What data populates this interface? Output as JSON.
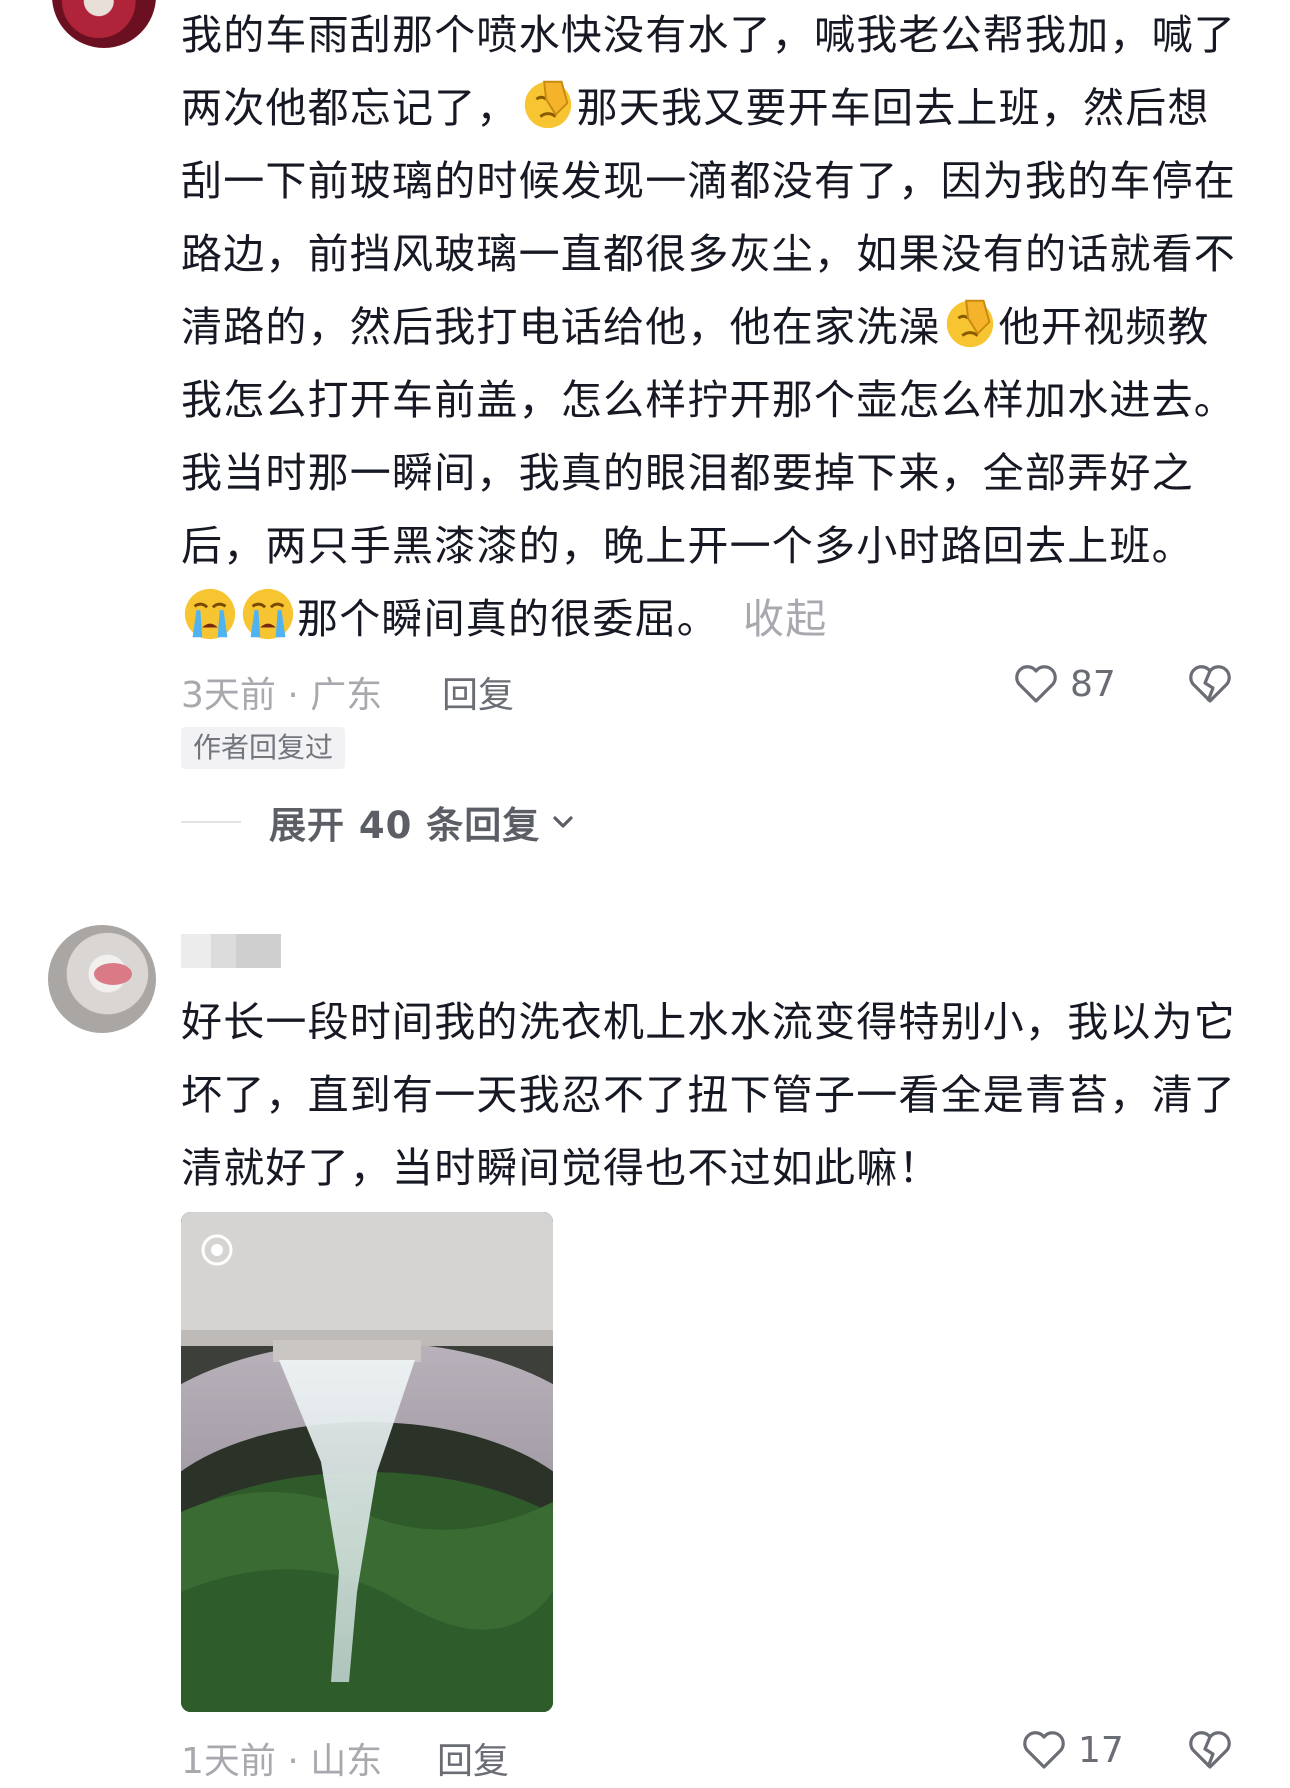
{
  "comments": [
    {
      "text_parts": [
        "我的车雨刮那个喷水快没有水了，喊我老公帮我加，喊了两次他都忘记了，",
        "那天我又要开车回去上班，然后想刮一下前玻璃的时候发现一滴都没有了，因为我的车停在路边，前挡风玻璃一直都很多灰尘，如果没有的话就看不清路的，然后我打电话给他，他在家洗澡",
        "他开视频教我怎么打开车前盖，怎么样拧开那个壶怎么样加水进去。我当时那一瞬间，我真的眼泪都要掉下来，全部弄好之后，两只手黑漆漆的，晚上开一个多小时路回去上班。",
        "那个瞬间真的很委屈。"
      ],
      "fold_label": "收起",
      "time_location": "3天前 · 广东",
      "reply_label": "回复",
      "like_count": "87",
      "author_badge": "作者回复过",
      "expand_replies": "展开 40 条回复",
      "emojis": [
        "facepalm-emoji",
        "facepalm-emoji",
        "crying-emoji",
        "crying-emoji"
      ]
    },
    {
      "text": "好长一段时间我的洗衣机上水水流变得特别小，我以为它坏了，直到有一天我忍不了扭下管子一看全是青苔，清了清就好了，当时瞬间觉得也不过如此嘛！",
      "time_location": "1天前 · 山东",
      "reply_label": "回复",
      "like_count": "17",
      "image": "washing-machine-water-photo"
    }
  ],
  "colors": {
    "text": "#161823",
    "meta": "#a8a9ae",
    "action": "#6b6d75",
    "badge_bg": "#f2f2f4"
  },
  "icons": [
    "heart-outline-icon",
    "broken-heart-icon",
    "chevron-down-icon"
  ]
}
